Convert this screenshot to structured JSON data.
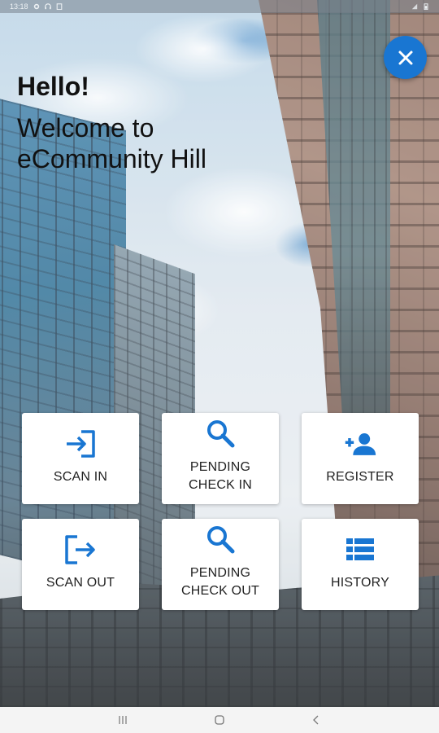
{
  "status_bar": {
    "time": "13:18",
    "icons": [
      "gear-icon",
      "headset-icon",
      "clipboard-icon"
    ],
    "right_icons": [
      "signal-icon",
      "battery-icon"
    ]
  },
  "greeting": {
    "hello": "Hello!",
    "welcome_line1": "Welcome to",
    "welcome_line2": "eCommunity Hill"
  },
  "close_button": {
    "icon": "close-icon",
    "color": "#1976d2"
  },
  "actions": [
    {
      "label": "SCAN IN",
      "icon": "login-arrow-icon"
    },
    {
      "label_line1": "PENDING",
      "label_line2": "CHECK IN",
      "icon": "search-icon"
    },
    {
      "label": "REGISTER",
      "icon": "person-add-icon"
    },
    {
      "label": "SCAN OUT",
      "icon": "logout-arrow-icon"
    },
    {
      "label_line1": "PENDING",
      "label_line2": "CHECK OUT",
      "icon": "search-icon"
    },
    {
      "label": "HISTORY",
      "icon": "list-icon"
    }
  ],
  "accent_color": "#1976d2",
  "nav_bar": {
    "buttons": [
      "recents-icon",
      "home-icon",
      "back-icon"
    ]
  }
}
